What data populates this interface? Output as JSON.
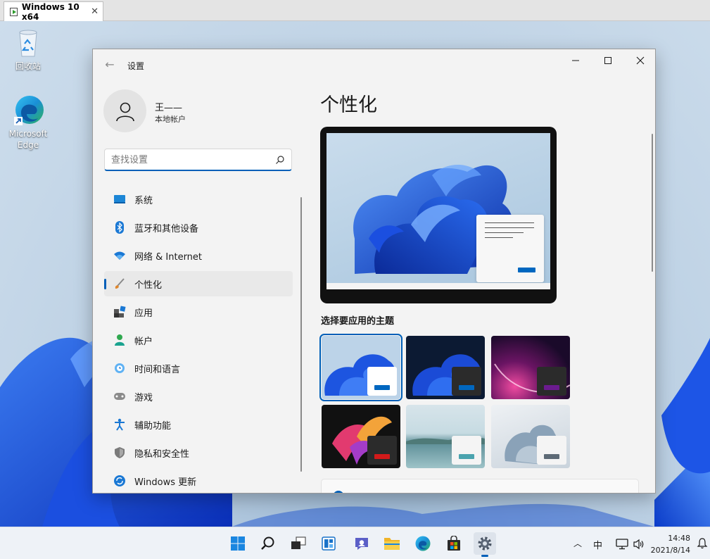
{
  "vm_tab": {
    "title": "Windows 10 x64",
    "close_glyph": "✕"
  },
  "desktop": {
    "icons": [
      {
        "label": "回收站",
        "icon": "recycle-bin-icon"
      },
      {
        "label": "Microsoft Edge",
        "icon": "edge-icon"
      }
    ]
  },
  "settings": {
    "title": "设置",
    "back_glyph": "←",
    "window_buttons": {
      "minimize": "minimize-icon",
      "maximize": "maximize-icon",
      "close": "close-icon"
    },
    "user": {
      "name": "王——",
      "account_type": "本地帐户"
    },
    "search": {
      "placeholder": "查找设置",
      "value": ""
    },
    "nav": [
      {
        "label": "系统",
        "icon": "monitor-icon"
      },
      {
        "label": "蓝牙和其他设备",
        "icon": "bluetooth-icon"
      },
      {
        "label": "网络 & Internet",
        "icon": "wifi-icon"
      },
      {
        "label": "个性化",
        "icon": "brush-icon",
        "selected": true
      },
      {
        "label": "应用",
        "icon": "apps-icon"
      },
      {
        "label": "帐户",
        "icon": "person-icon"
      },
      {
        "label": "时间和语言",
        "icon": "globe-clock-icon"
      },
      {
        "label": "游戏",
        "icon": "gamepad-icon"
      },
      {
        "label": "辅助功能",
        "icon": "accessibility-icon"
      },
      {
        "label": "隐私和安全性",
        "icon": "shield-icon"
      },
      {
        "label": "Windows 更新",
        "icon": "update-icon"
      }
    ],
    "page_title": "个性化",
    "themes_heading": "选择要应用的主题",
    "themes": [
      {
        "name": "light-bloom",
        "accent": "#0067c0",
        "selected": true
      },
      {
        "name": "dark-bloom",
        "accent": "#0067c0"
      },
      {
        "name": "glow",
        "accent": "#6b1b8f"
      },
      {
        "name": "captured-motion",
        "accent": "#d21a1a"
      },
      {
        "name": "sunrise",
        "accent": "#4aa3ae"
      },
      {
        "name": "flow",
        "accent": "#5d6a76"
      }
    ]
  },
  "taskbar": {
    "apps": [
      {
        "name": "start",
        "icon": "windows-logo-icon"
      },
      {
        "name": "search",
        "icon": "search-icon"
      },
      {
        "name": "task-view",
        "icon": "task-view-icon"
      },
      {
        "name": "widgets",
        "icon": "widgets-icon"
      },
      {
        "name": "chat",
        "icon": "teams-chat-icon"
      },
      {
        "name": "file-explorer",
        "icon": "folder-icon"
      },
      {
        "name": "edge",
        "icon": "edge-icon"
      },
      {
        "name": "store",
        "icon": "store-icon"
      },
      {
        "name": "settings",
        "icon": "gear-icon",
        "active": true
      }
    ],
    "tray": {
      "chevron": "︿",
      "ime": "中"
    },
    "clock": {
      "time": "14:48",
      "date": "2021/8/14"
    }
  },
  "colors": {
    "accent": "#005fb8",
    "window_bg": "#f3f3f3",
    "taskbar_bg": "#eef2f7"
  }
}
